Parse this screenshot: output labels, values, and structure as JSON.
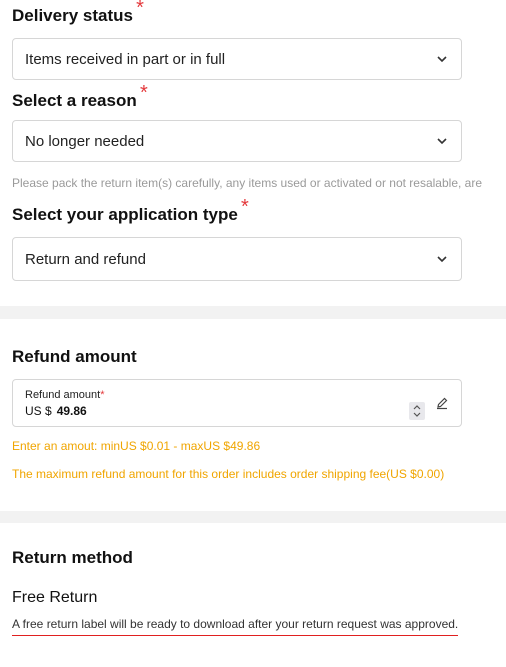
{
  "delivery": {
    "title": "Delivery status",
    "required_mark": "*",
    "selected": "Items received in part or in full"
  },
  "reason": {
    "title": "Select a reason",
    "required_mark": "*",
    "selected": "No longer needed",
    "hint": "Please pack the return item(s) carefully, any items used or activated or not resalable, are"
  },
  "application": {
    "title": "Select your application type",
    "required_mark": "*",
    "selected": "Return and refund"
  },
  "refund": {
    "title": "Refund amount",
    "field_label": "Refund amount",
    "required_mark": "*",
    "currency": "US $",
    "value": "49.86",
    "range_note": "Enter an amout: minUS $0.01 - maxUS $49.86",
    "shipping_note": "The maximum refund amount for this order includes order shipping fee(US $0.00)"
  },
  "return_method": {
    "title": "Return method",
    "option_title": "Free Return",
    "option_desc": "A free return label will be ready to download after your return request was approved."
  },
  "icons": {
    "dropdown": "chevron-down-icon",
    "stepper": "stepper-icon",
    "edit": "pencil-icon"
  },
  "colors": {
    "required": "#e4393c",
    "warning": "#f0a500",
    "underline": "#e02020"
  }
}
